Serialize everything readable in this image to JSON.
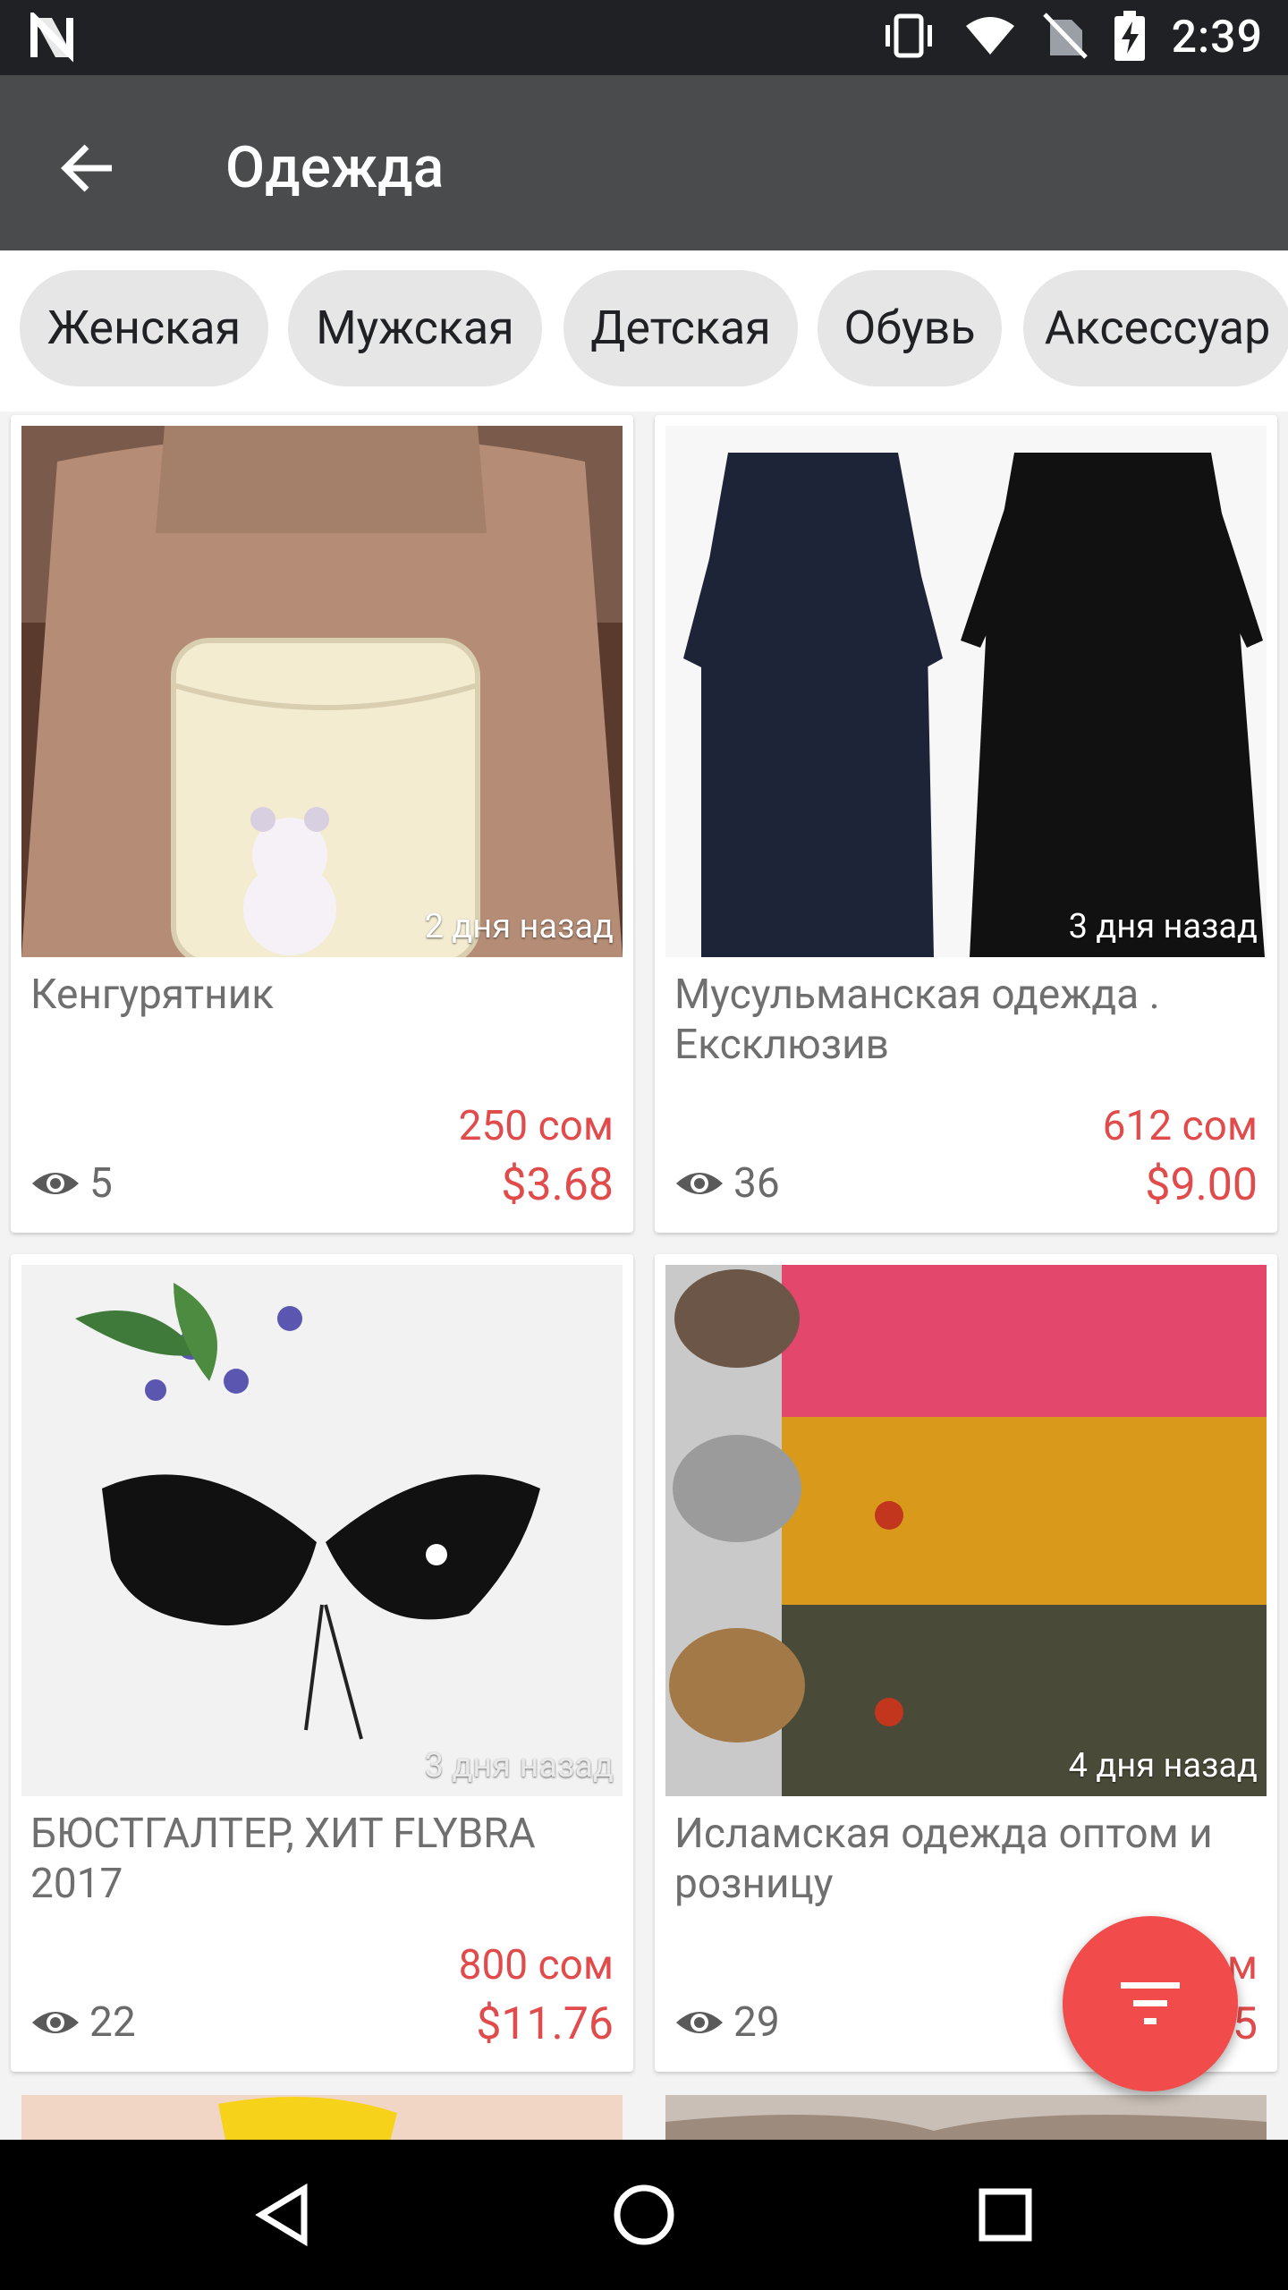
{
  "status": {
    "time": "2:39",
    "icons": [
      "n-logo-icon",
      "vibrate-icon",
      "wifi-icon",
      "no-sim-icon",
      "battery-charging-icon"
    ]
  },
  "appbar": {
    "title": "Одежда"
  },
  "chips": [
    {
      "label": "Женская"
    },
    {
      "label": "Мужская"
    },
    {
      "label": "Детская"
    },
    {
      "label": "Обувь"
    },
    {
      "label": "Аксессуар"
    }
  ],
  "listings": [
    {
      "title": "Кенгурятник",
      "ago": "2 дня назад",
      "price_som": "250 сом",
      "price_usd": "$3.68",
      "views": "5"
    },
    {
      "title": "Мусульманская одежда . Ексклюзив",
      "ago": "3 дня назад",
      "price_som": "612 сом",
      "price_usd": "$9.00",
      "views": "36"
    },
    {
      "title": "БЮСТГАЛТЕР, ХИТ FLYBRA 2017",
      "ago": "3 дня назад",
      "price_som": "800 сом",
      "price_usd": "$11.76",
      "views": "22"
    },
    {
      "title": "Исламская одежда  оптом и розницу",
      "ago": "4 дня назад",
      "price_som": "м",
      "price_usd": "5",
      "views": "29"
    }
  ],
  "fab": {
    "icon": "filter-icon",
    "color": "#f24b4b"
  },
  "colors": {
    "price": "#e14b4b",
    "appbar": "#4a4b4d",
    "statusbar": "#202124"
  }
}
